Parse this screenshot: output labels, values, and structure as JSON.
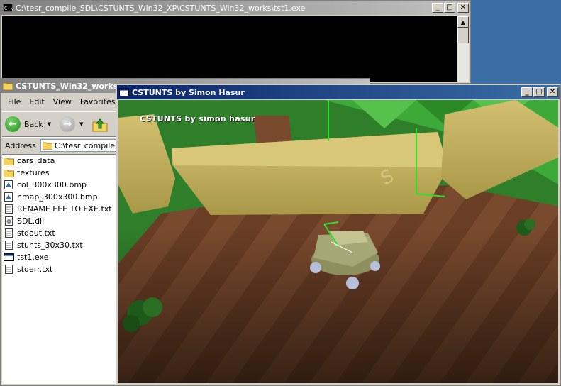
{
  "console": {
    "title": "C:\\tesr_compile_SDL\\CSTUNTS_Win32_XP\\CSTUNTS_Win32_works\\tst1.exe",
    "icon": "console-icon",
    "controls": {
      "minimize": "_",
      "maximize": "□",
      "close": "✕"
    }
  },
  "explorer": {
    "title": "CSTUNTS_Win32_works",
    "menu": [
      "File",
      "Edit",
      "View",
      "Favorites"
    ],
    "toolbar": {
      "back_label": "Back"
    },
    "address": {
      "label": "Address",
      "value": "C:\\tesr_compile_SDL"
    },
    "files": [
      {
        "name": "cars_data",
        "icon": "folder-icon"
      },
      {
        "name": "textures",
        "icon": "folder-icon"
      },
      {
        "name": "col_300x300.bmp",
        "icon": "bitmap-icon"
      },
      {
        "name": "hmap_300x300.bmp",
        "icon": "bitmap-icon"
      },
      {
        "name": "RENAME EEE TO EXE.txt",
        "icon": "text-file-icon"
      },
      {
        "name": "SDL.dll",
        "icon": "dll-icon"
      },
      {
        "name": "stdout.txt",
        "icon": "text-file-icon"
      },
      {
        "name": "stunts_30x30.txt",
        "icon": "text-file-icon"
      },
      {
        "name": "tst1.exe",
        "icon": "exe-icon"
      },
      {
        "name": "stderr.txt",
        "icon": "text-file-icon"
      }
    ]
  },
  "game": {
    "title": "CSTUNTS by Simon Hasur",
    "hud_text": "CSTUNTS by simon hasur",
    "controls": {
      "minimize": "_",
      "maximize": "□",
      "close": "✕"
    }
  },
  "colors": {
    "desktop": "#3a6ea5",
    "active_title": "#0a246a",
    "inactive_title": "#808080",
    "grass": "#2f8a2a",
    "dirt": "#7a4a2e",
    "wall": "#c7b566"
  }
}
